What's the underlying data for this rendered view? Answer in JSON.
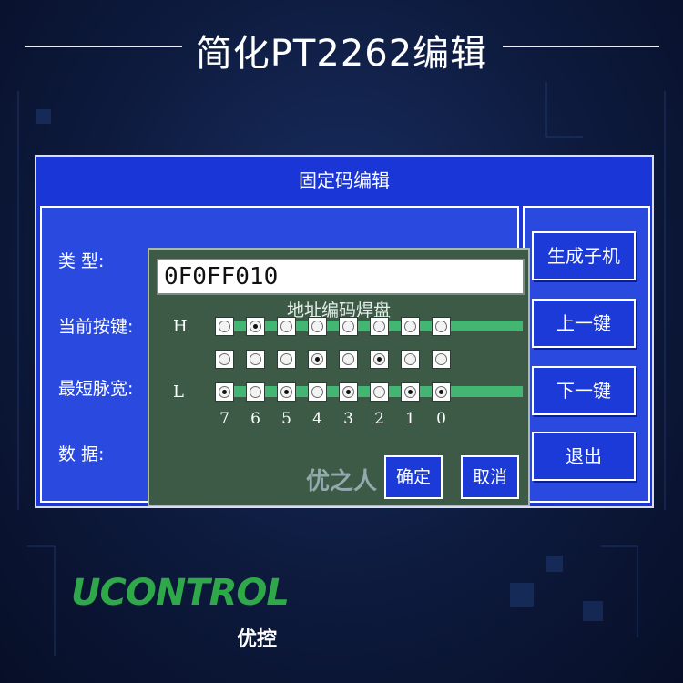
{
  "header": {
    "title": "简化PT2262编辑"
  },
  "screen": {
    "title": "固定码编辑",
    "labels": {
      "type": "类    型:",
      "current_key": "当前按键:",
      "min_pulse": "最短脉宽:",
      "data": "数    据:"
    },
    "side_buttons": {
      "generate_slave": "生成子机",
      "prev_key": "上一键",
      "next_key": "下一键",
      "exit": "退出"
    }
  },
  "dialog": {
    "code_value": "0F0FF010",
    "caption": "地址编码焊盘",
    "row_h_label": "H",
    "row_l_label": "L",
    "rows": [
      [
        false,
        true,
        false,
        false,
        false,
        false,
        false,
        false
      ],
      [
        false,
        false,
        false,
        true,
        false,
        true,
        false,
        false
      ],
      [
        true,
        false,
        true,
        false,
        true,
        false,
        true,
        true
      ]
    ],
    "bit_labels": [
      "7",
      "6",
      "5",
      "4",
      "3",
      "2",
      "1",
      "0"
    ],
    "ok_label": "确定",
    "cancel_label": "取消"
  },
  "brand": {
    "logo_text": "UCONTROL",
    "logo_subtext": "优控",
    "watermark": "优之人",
    "accent_color": "#2fa84a"
  }
}
